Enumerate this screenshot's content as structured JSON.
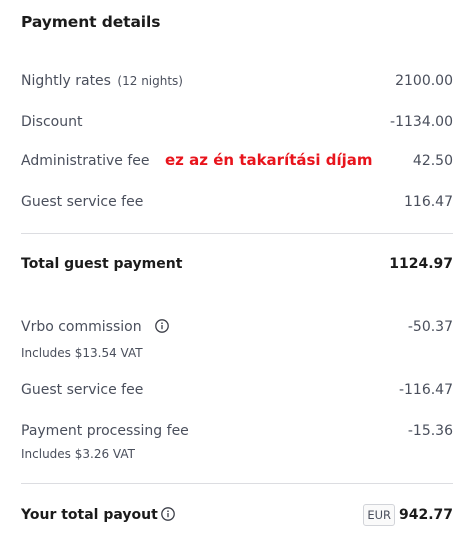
{
  "header": {
    "title": "Payment details"
  },
  "charges": {
    "nightly": {
      "label": "Nightly rates",
      "detail": "(12 nights)",
      "value": "2100.00"
    },
    "discount": {
      "label": "Discount",
      "value": "-1134.00"
    },
    "admin_fee": {
      "label": "Administrative fee",
      "value": "42.50"
    },
    "guest_fee": {
      "label": "Guest service fee",
      "value": "116.47"
    }
  },
  "annotation": {
    "text": "ez az én takarítási díjam",
    "color": "#e8141c"
  },
  "total_guest": {
    "label": "Total guest payment",
    "value": "1124.97"
  },
  "deductions": {
    "commission": {
      "label": "Vrbo commission",
      "value": "-50.37",
      "sub": "Includes $13.54 VAT"
    },
    "guest_fee": {
      "label": "Guest service fee",
      "value": "-116.47"
    },
    "processing": {
      "label": "Payment processing fee",
      "value": "-15.36",
      "sub": "Includes $3.26 VAT"
    }
  },
  "payout": {
    "label": "Your total payout",
    "currency": "EUR",
    "value": "942.77"
  },
  "icons": {
    "info": "info-circle-icon"
  }
}
